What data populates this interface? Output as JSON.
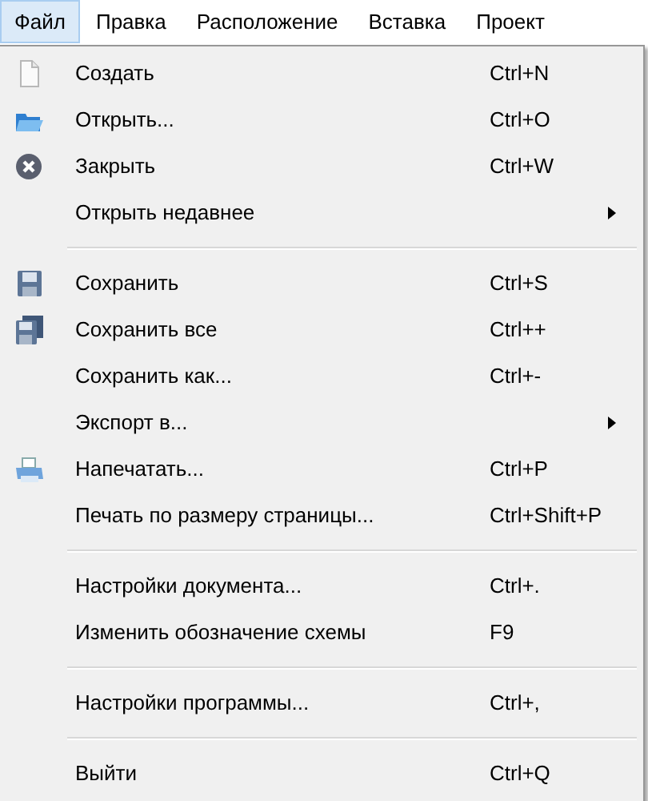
{
  "menubar": [
    {
      "label": "Файл",
      "selected": true
    },
    {
      "label": "Правка",
      "selected": false
    },
    {
      "label": "Расположение",
      "selected": false
    },
    {
      "label": "Вставка",
      "selected": false
    },
    {
      "label": "Проект",
      "selected": false
    }
  ],
  "menu": [
    {
      "kind": "document",
      "label": "Создать",
      "shortcut": "Ctrl+N"
    },
    {
      "kind": "folder",
      "label": "Открыть...",
      "shortcut": "Ctrl+O"
    },
    {
      "kind": "close",
      "label": "Закрыть",
      "shortcut": "Ctrl+W"
    },
    {
      "kind": "plain",
      "label": "Открыть недавнее",
      "submenu": true
    },
    {
      "kind": "separator"
    },
    {
      "kind": "disk",
      "label": "Сохранить",
      "shortcut": "Ctrl+S"
    },
    {
      "kind": "disks",
      "label": "Сохранить все",
      "shortcut": "Ctrl++"
    },
    {
      "kind": "plain",
      "label": "Сохранить как...",
      "shortcut": "Ctrl+-"
    },
    {
      "kind": "plain",
      "label": "Экспорт в...",
      "submenu": true
    },
    {
      "kind": "printer",
      "label": "Напечатать...",
      "shortcut": "Ctrl+P"
    },
    {
      "kind": "plain",
      "label": "Печать по размеру страницы...",
      "shortcut": "Ctrl+Shift+P"
    },
    {
      "kind": "separator"
    },
    {
      "kind": "plain",
      "label": "Настройки документа...",
      "shortcut": "Ctrl+."
    },
    {
      "kind": "plain",
      "label": "Изменить обозначение схемы",
      "shortcut": "F9"
    },
    {
      "kind": "separator"
    },
    {
      "kind": "plain",
      "label": "Настройки программы...",
      "shortcut": "Ctrl+,"
    },
    {
      "kind": "separator"
    },
    {
      "kind": "plain",
      "label": "Выйти",
      "shortcut": "Ctrl+Q"
    }
  ]
}
